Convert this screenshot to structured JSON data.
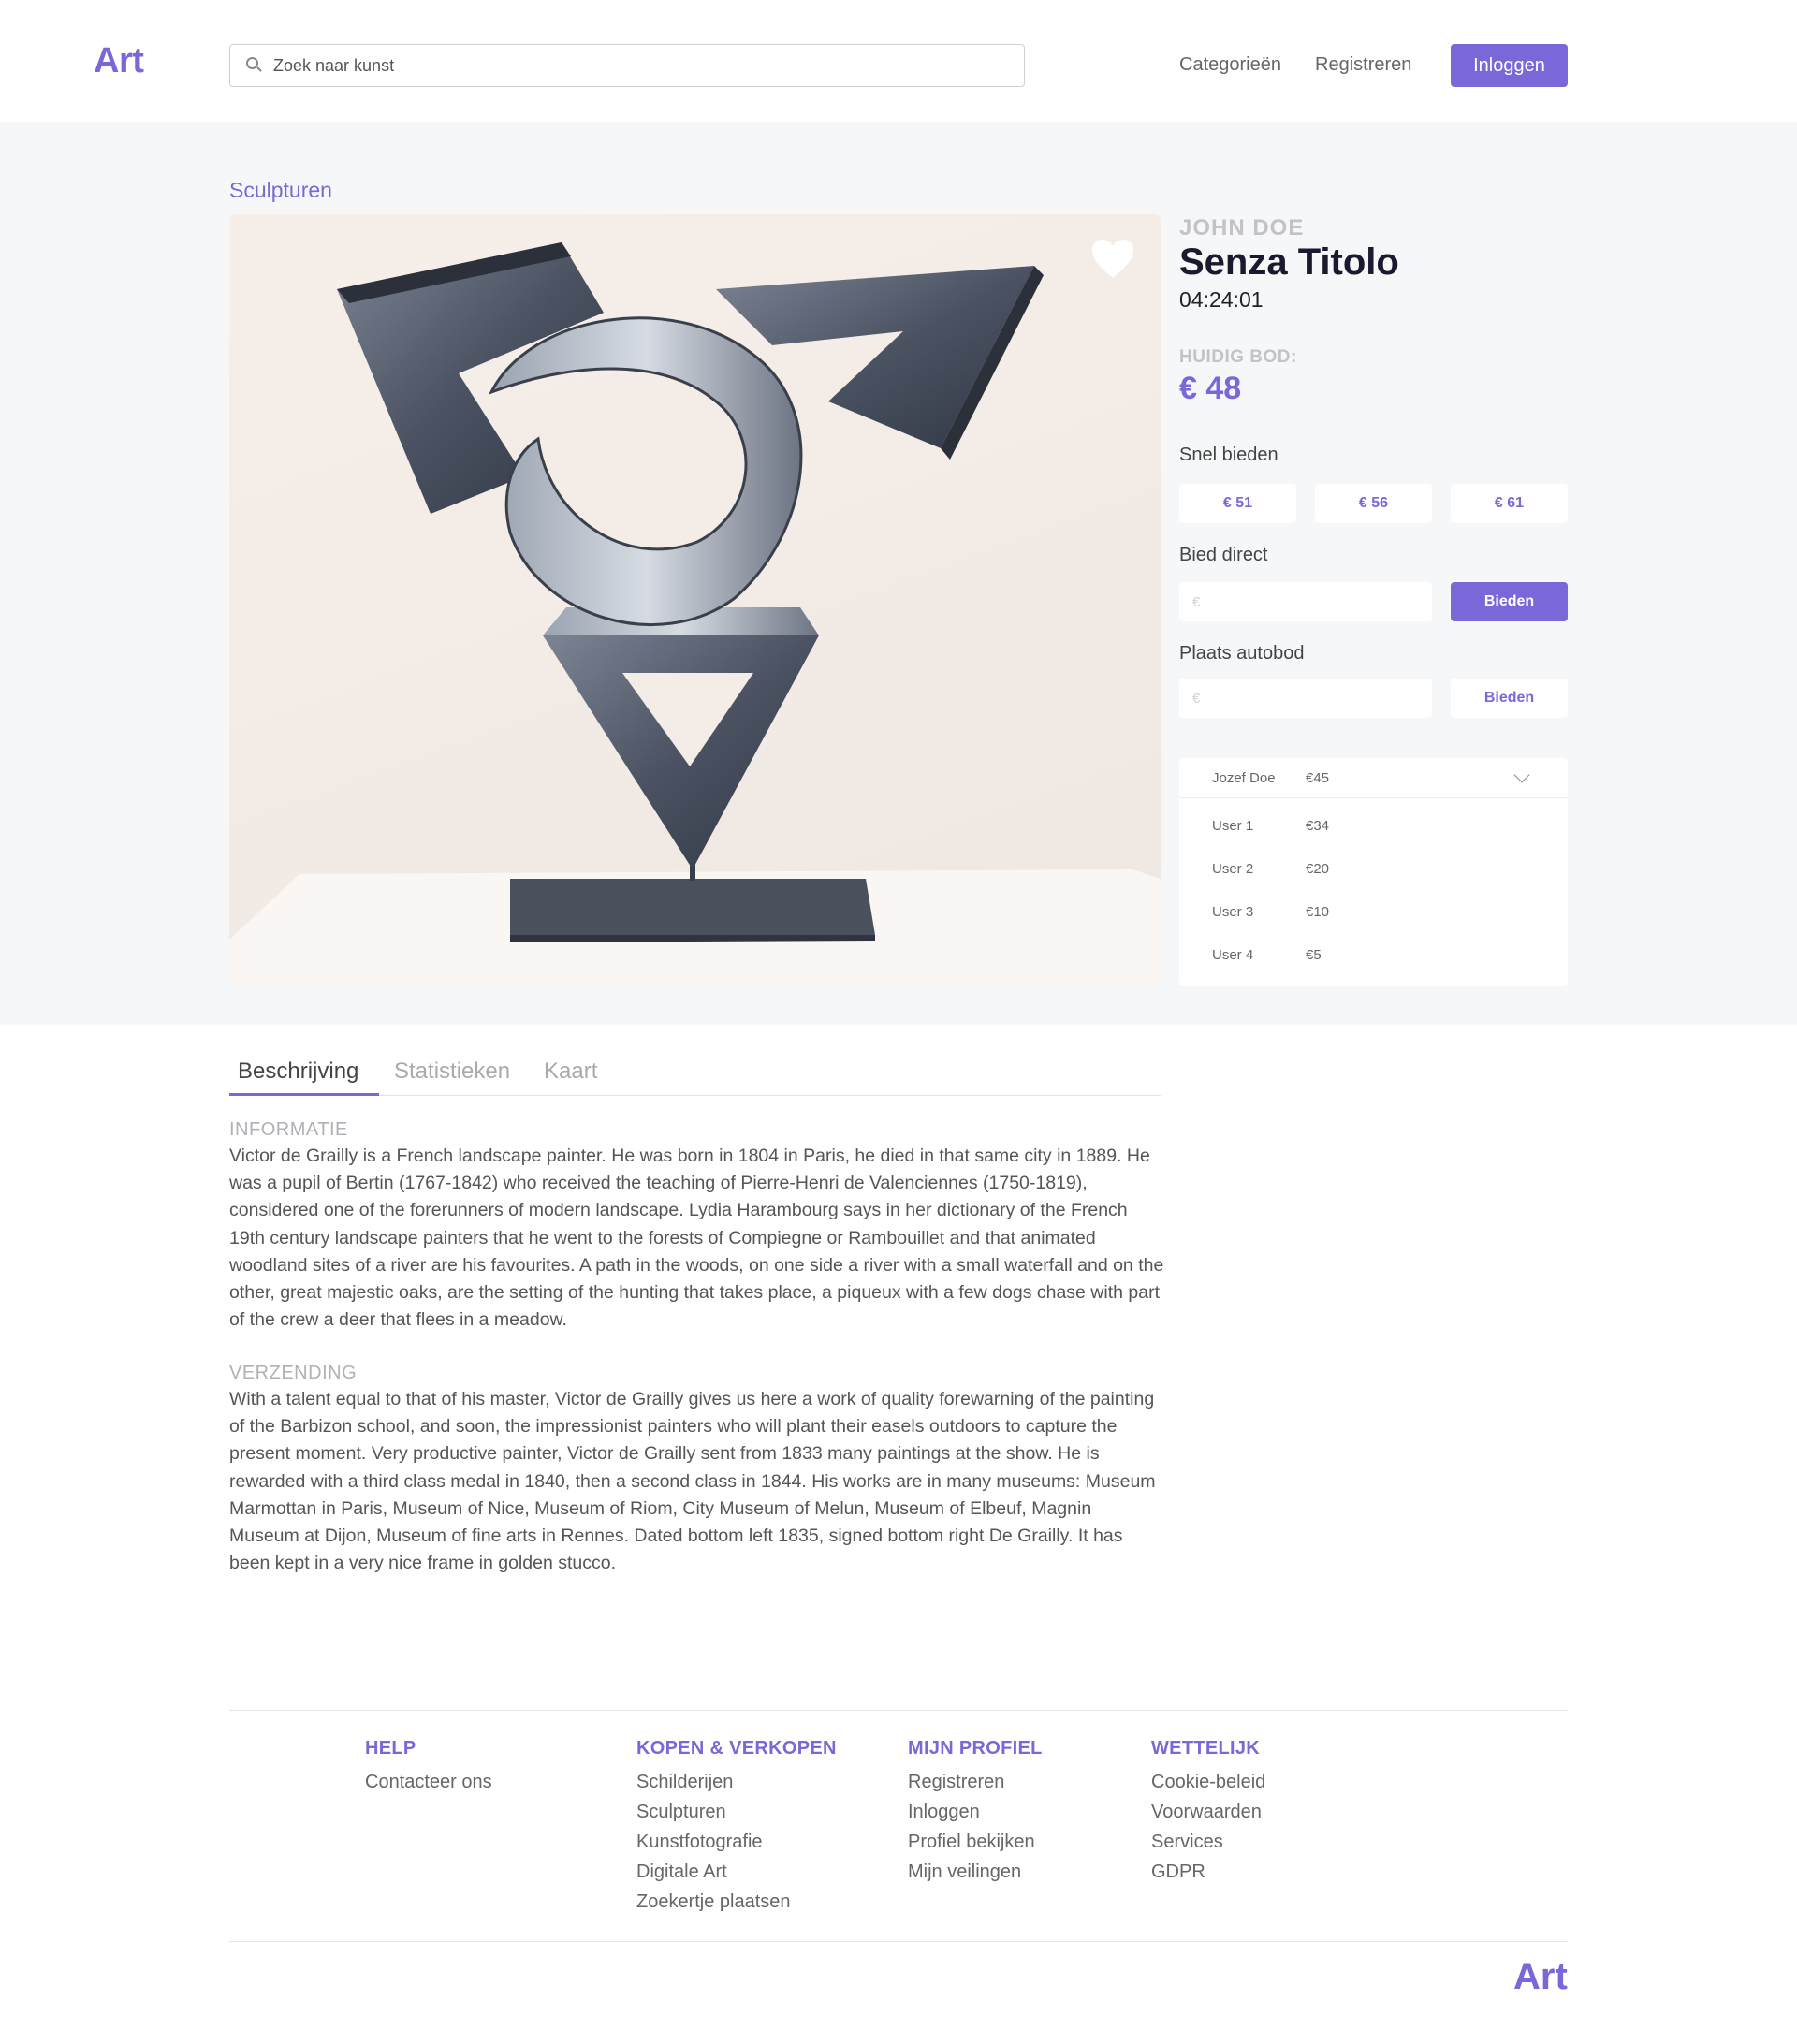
{
  "header": {
    "logo": "Art",
    "search_placeholder": "Zoek naar kunst",
    "nav": [
      "Categorieën",
      "Registreren"
    ],
    "login_label": "Inloggen"
  },
  "breadcrumb": "Sculpturen",
  "artwork": {
    "artist": "JOHN DOE",
    "title": "Senza Titolo",
    "timer": "04:24:01",
    "current_bid_label": "HUIDIG BOD:",
    "current_bid_value": "€ 48"
  },
  "bidding": {
    "quick_label": "Snel bieden",
    "quick_amounts": [
      "€ 51",
      "€ 56",
      "€ 61"
    ],
    "direct_label": "Bied direct",
    "direct_placeholder": "€",
    "direct_button": "Bieden",
    "auto_label": "Plaats autobod",
    "auto_placeholder": "€",
    "auto_button": "Bieden"
  },
  "history": {
    "top": {
      "name": "Jozef Doe",
      "amount": "€45"
    },
    "rows": [
      {
        "name": "User 1",
        "amount": "€34"
      },
      {
        "name": "User 2",
        "amount": "€20"
      },
      {
        "name": "User 3",
        "amount": "€10"
      },
      {
        "name": "User 4",
        "amount": "€5"
      }
    ]
  },
  "tabs": [
    "Beschrijving",
    "Statistieken",
    "Kaart"
  ],
  "description": {
    "info_label": "INFORMATIE",
    "info_text": "Victor de Grailly is a French landscape painter. He was born in 1804 in Paris, he died in that same city in 1889. He was a pupil of Bertin (1767-1842) who received the teaching of Pierre-Henri de Valenciennes (1750-1819), considered one of the forerunners of modern landscape. Lydia Harambourg says in her dictionary of the French 19th century landscape painters that he went to the forests of Compiegne or Rambouillet and that animated woodland sites of a river are his favourites. A path in the woods, on one side a river with a small waterfall and on the other, great majestic oaks, are the setting of the hunting that takes place, a piqueux with a few dogs chase with part of the crew a deer that flees in a meadow.",
    "shipping_label": "VERZENDING",
    "shipping_text": "With a talent equal to that of his master, Victor de Grailly gives us here a work of quality forewarning of the painting of the Barbizon school, and soon, the impressionist painters who will plant their easels outdoors to capture the present moment. Very productive painter, Victor de Grailly sent from 1833 many paintings at the show. He is rewarded with a third class medal in 1840, then a second class in 1844. His works are in many museums: Museum Marmottan in Paris, Museum of Nice, Museum of Riom, City Museum of Melun, Museum of Elbeuf, Magnin Museum at Dijon, Museum of fine arts in Rennes. Dated bottom left 1835, signed bottom right De Grailly. It has been kept in a very nice frame in golden stucco."
  },
  "footer": {
    "columns": [
      {
        "title": "HELP",
        "items": [
          "Contacteer ons"
        ]
      },
      {
        "title": "KOPEN & VERKOPEN",
        "items": [
          "Schilderijen",
          "Sculpturen",
          "Kunstfotografie",
          "Digitale Art",
          "Zoekertje plaatsen"
        ]
      },
      {
        "title": "MIJN PROFIEL",
        "items": [
          "Registreren",
          "Inloggen",
          "Profiel bekijken",
          "Mijn veilingen"
        ]
      },
      {
        "title": "WETTELIJK",
        "items": [
          "Cookie-beleid",
          "Voorwaarden",
          "Services",
          "GDPR"
        ]
      }
    ],
    "logo": "Art"
  },
  "colors": {
    "accent": "#7a67d8",
    "band": "#f6f7f9"
  }
}
